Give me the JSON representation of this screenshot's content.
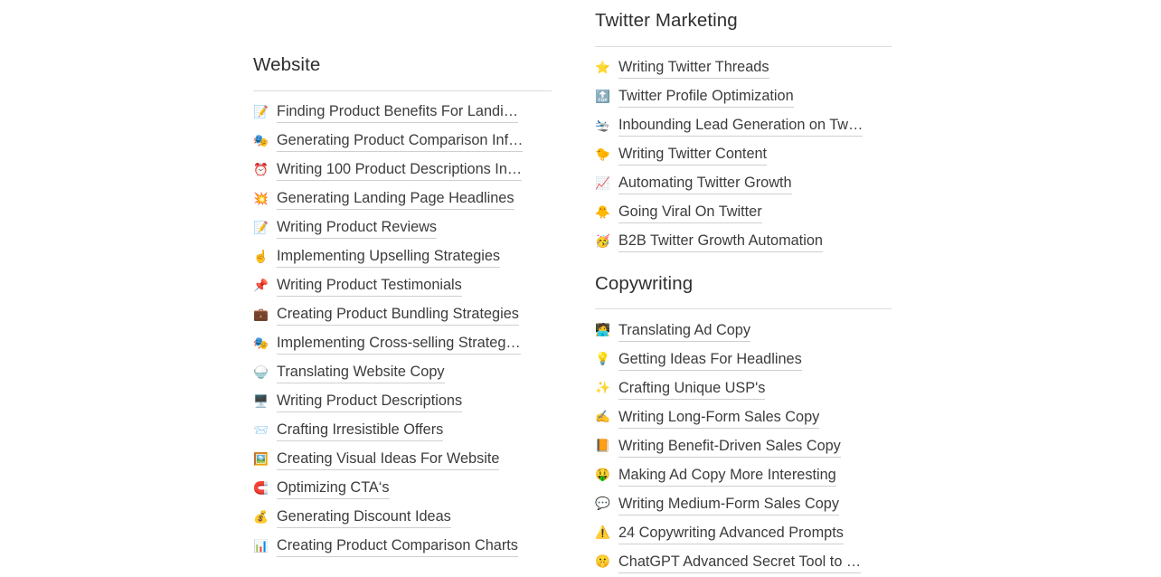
{
  "sections": [
    {
      "id": "website",
      "title": "Website",
      "items": [
        {
          "icon": "📝",
          "icon_name": "memo-icon",
          "label": "Finding Product Benefits For Landi…"
        },
        {
          "icon": "🎭",
          "icon_name": "performing-arts-icon",
          "label": "Generating Product Comparison Inf…"
        },
        {
          "icon": "⏰",
          "icon_name": "alarm-clock-icon",
          "label": "Writing 100 Product Descriptions In…"
        },
        {
          "icon": "💥",
          "icon_name": "collision-icon",
          "label": "Generating Landing Page Headlines"
        },
        {
          "icon": "📝",
          "icon_name": "memo-icon",
          "label": "Writing Product Reviews"
        },
        {
          "icon": "☝️",
          "icon_name": "index-pointing-up-icon",
          "label": "Implementing Upselling Strategies"
        },
        {
          "icon": "📌",
          "icon_name": "pushpin-icon",
          "label": "Writing Product Testimonials"
        },
        {
          "icon": "💼",
          "icon_name": "briefcase-icon",
          "label": "Creating Product Bundling Strategies"
        },
        {
          "icon": "🎭",
          "icon_name": "performing-arts-icon",
          "label": "Implementing Cross-selling Strateg…"
        },
        {
          "icon": "🍚",
          "icon_name": "bowl-of-rice-icon",
          "label": "Translating Website Copy"
        },
        {
          "icon": "🖥️",
          "icon_name": "desktop-computer-icon",
          "label": "Writing Product Descriptions"
        },
        {
          "icon": "📨",
          "icon_name": "incoming-envelope-icon",
          "label": "Crafting Irresistible Offers"
        },
        {
          "icon": "🖼️",
          "icon_name": "framed-picture-icon",
          "label": "Creating Visual Ideas For Website"
        },
        {
          "icon": "🧲",
          "icon_name": "magnet-icon",
          "label": "Optimizing CTA‘s"
        },
        {
          "icon": "💰",
          "icon_name": "money-bag-icon",
          "label": "Generating Discount Ideas"
        },
        {
          "icon": "📊",
          "icon_name": "bar-chart-icon",
          "label": "Creating Product Comparison Charts"
        }
      ]
    },
    {
      "id": "twitter-marketing",
      "title": "Twitter Marketing",
      "items": [
        {
          "icon": "⭐",
          "icon_name": "star-icon",
          "label": "Writing Twitter Threads"
        },
        {
          "icon": "🔝",
          "icon_name": "top-arrow-icon",
          "label": "Twitter Profile Optimization"
        },
        {
          "icon": "🛬",
          "icon_name": "airplane-arriving-icon",
          "label": "Inbounding Lead Generation on Tw…"
        },
        {
          "icon": "🐤",
          "icon_name": "baby-chick-icon",
          "label": "Writing Twitter Content"
        },
        {
          "icon": "📈",
          "icon_name": "chart-increasing-icon",
          "label": "Automating Twitter Growth"
        },
        {
          "icon": "🐥",
          "icon_name": "front-facing-baby-chick-icon",
          "label": "Going Viral On Twitter"
        },
        {
          "icon": "🥳",
          "icon_name": "partying-face-icon",
          "label": "B2B Twitter Growth Automation"
        }
      ]
    },
    {
      "id": "copywriting",
      "title": "Copywriting",
      "items": [
        {
          "icon": "🧑‍💻",
          "icon_name": "technologist-icon",
          "label": "Translating Ad Copy"
        },
        {
          "icon": "💡",
          "icon_name": "light-bulb-icon",
          "label": "Getting Ideas For Headlines"
        },
        {
          "icon": "✨",
          "icon_name": "sparkles-icon",
          "label": "Crafting Unique USP's"
        },
        {
          "icon": "✍️",
          "icon_name": "writing-hand-icon",
          "label": "Writing Long-Form Sales Copy"
        },
        {
          "icon": "📙",
          "icon_name": "orange-book-icon",
          "label": "Writing Benefit-Driven Sales Copy"
        },
        {
          "icon": "🤑",
          "icon_name": "money-mouth-face-icon",
          "label": "Making Ad Copy More Interesting"
        },
        {
          "icon": "💬",
          "icon_name": "speech-balloon-icon",
          "label": "Writing Medium-Form Sales Copy"
        },
        {
          "icon": "⚠️",
          "icon_name": "warning-icon",
          "label": "24 Copywriting Advanced Prompts"
        },
        {
          "icon": "🤫",
          "icon_name": "shushing-face-icon",
          "label": "ChatGPT Advanced Secret Tool to …"
        }
      ]
    }
  ],
  "layout": {
    "left_column_sections": [
      "website"
    ],
    "right_column_sections": [
      "twitter-marketing",
      "copywriting"
    ]
  },
  "colors": {
    "background": "#ffffff",
    "text": "#3c3c3c",
    "heading": "#2f2f2f",
    "rule": "#dcdcdc",
    "link_underline": "#cfcfcf"
  }
}
